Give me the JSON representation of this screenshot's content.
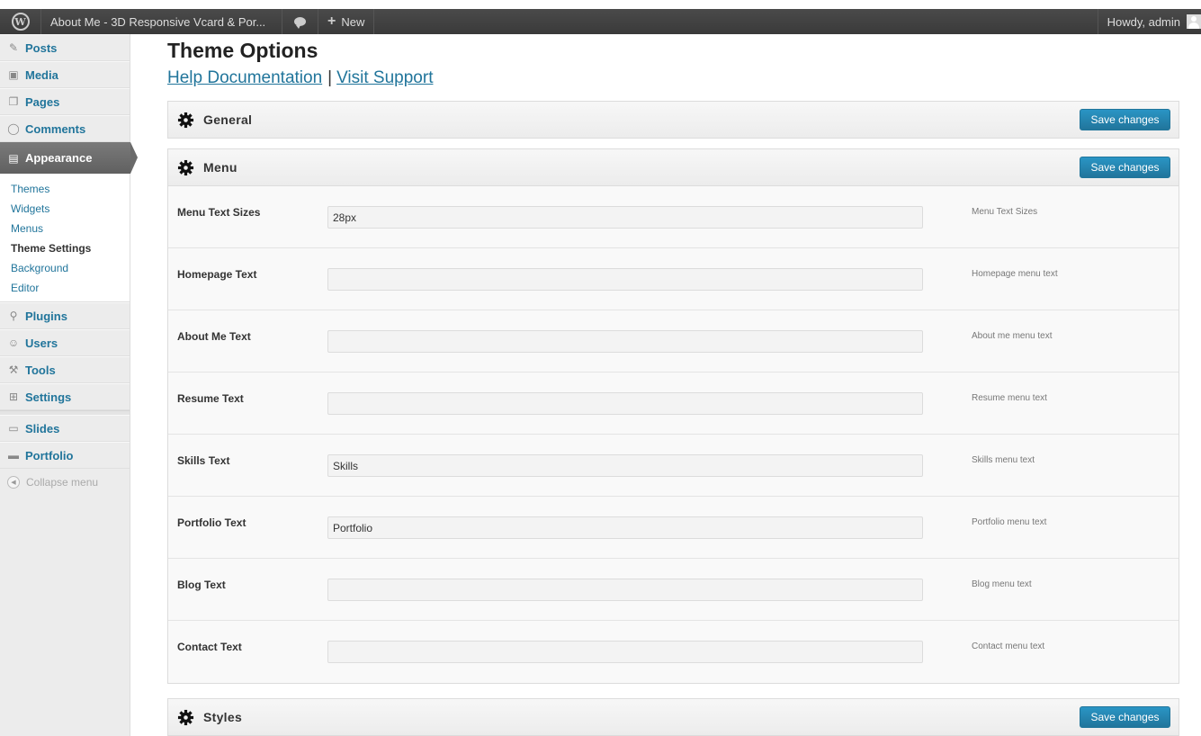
{
  "adminbar": {
    "site_title": "About Me - 3D Responsive Vcard & Por...",
    "new_label": "New",
    "howdy": "Howdy, admin"
  },
  "sidebar": {
    "items_top": [
      {
        "label": "Posts",
        "icon": "pin-icon"
      },
      {
        "label": "Media",
        "icon": "media-icon"
      },
      {
        "label": "Pages",
        "icon": "pages-icon"
      },
      {
        "label": "Comments",
        "icon": "comments-icon"
      }
    ],
    "appearance": {
      "label": "Appearance",
      "icon": "appearance-icon"
    },
    "submenu": [
      {
        "label": "Themes"
      },
      {
        "label": "Widgets"
      },
      {
        "label": "Menus"
      },
      {
        "label": "Theme Settings",
        "active": true
      },
      {
        "label": "Background"
      },
      {
        "label": "Editor"
      }
    ],
    "items_bottom": [
      {
        "label": "Plugins",
        "icon": "plug-icon"
      },
      {
        "label": "Users",
        "icon": "users-icon"
      },
      {
        "label": "Tools",
        "icon": "tools-icon"
      },
      {
        "label": "Settings",
        "icon": "settings-icon"
      }
    ],
    "items_custom": [
      {
        "label": "Slides",
        "icon": "slides-icon"
      },
      {
        "label": "Portfolio",
        "icon": "portfolio-icon"
      }
    ],
    "collapse_label": "Collapse menu"
  },
  "main": {
    "title": "Theme Options",
    "help_link": "Help Documentation",
    "separator": "|",
    "support_link": "Visit Support",
    "save_label": "Save changes",
    "panels": {
      "general": {
        "title": "General"
      },
      "menu": {
        "title": "Menu",
        "rows": [
          {
            "label": "Menu Text Sizes",
            "value": "28px",
            "desc": "Menu Text Sizes"
          },
          {
            "label": "Homepage Text",
            "value": "",
            "desc": "Homepage menu text"
          },
          {
            "label": "About Me Text",
            "value": "",
            "desc": "About me menu text"
          },
          {
            "label": "Resume Text",
            "value": "",
            "desc": "Resume menu text"
          },
          {
            "label": "Skills Text",
            "value": "Skills",
            "desc": "Skills menu text"
          },
          {
            "label": "Portfolio Text",
            "value": "Portfolio",
            "desc": "Portfolio menu text"
          },
          {
            "label": "Blog Text",
            "value": "",
            "desc": "Blog menu text"
          },
          {
            "label": "Contact Text",
            "value": "",
            "desc": "Contact menu text"
          }
        ]
      },
      "styles": {
        "title": "Styles"
      }
    }
  }
}
